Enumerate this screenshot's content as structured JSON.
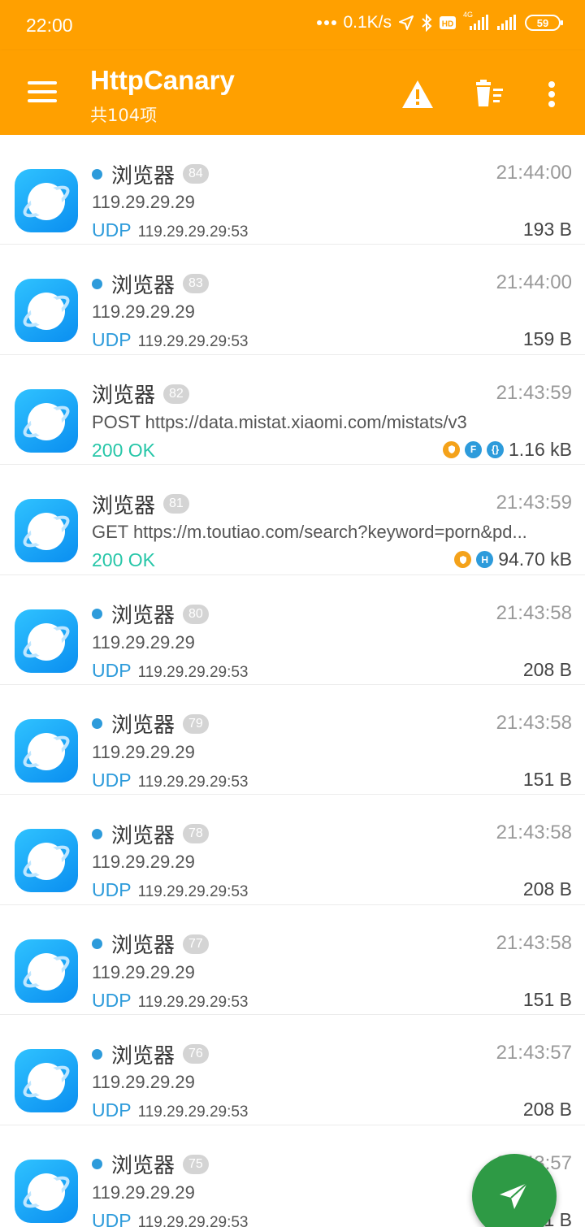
{
  "statusbar": {
    "time": "22:00",
    "speed": "0.1K/s",
    "network": "4G",
    "battery": "59",
    "icons": [
      "dots-icon",
      "location-arrow-icon",
      "bluetooth-icon",
      "hd-icon",
      "signal-icon",
      "signal-icon",
      "battery-icon"
    ]
  },
  "appbar": {
    "title": "HttpCanary",
    "subtitle": "共104项",
    "actions": [
      "warning-icon",
      "clear-list-icon",
      "more-vert-icon"
    ]
  },
  "rows": [
    {
      "dot": true,
      "app": "浏览器",
      "index": "84",
      "time": "21:44:00",
      "line2": "119.29.29.29",
      "protocol": "UDP",
      "dest": "119.29.29.29:53",
      "size": "193 B",
      "icons": []
    },
    {
      "dot": true,
      "app": "浏览器",
      "index": "83",
      "time": "21:44:00",
      "line2": "119.29.29.29",
      "protocol": "UDP",
      "dest": "119.29.29.29:53",
      "size": "159 B",
      "icons": []
    },
    {
      "dot": false,
      "app": "浏览器",
      "index": "82",
      "time": "21:43:59",
      "line2": "POST https://data.mistat.xiaomi.com/mistats/v3",
      "status": "200 OK",
      "size": "1.16 kB",
      "icons": [
        {
          "color": "orange",
          "label": "",
          "name": "https-lock-icon"
        },
        {
          "color": "blue",
          "label": "F",
          "name": "form-icon"
        },
        {
          "color": "blue",
          "label": "{}",
          "name": "json-icon"
        }
      ]
    },
    {
      "dot": false,
      "app": "浏览器",
      "index": "81",
      "time": "21:43:59",
      "line2": "GET https://m.toutiao.com/search?keyword=porn&pd...",
      "status": "200 OK",
      "size": "94.70 kB",
      "icons": [
        {
          "color": "orange",
          "label": "",
          "name": "https-lock-icon"
        },
        {
          "color": "blue",
          "label": "H",
          "name": "html-icon"
        }
      ]
    },
    {
      "dot": true,
      "app": "浏览器",
      "index": "80",
      "time": "21:43:58",
      "line2": "119.29.29.29",
      "protocol": "UDP",
      "dest": "119.29.29.29:53",
      "size": "208 B",
      "icons": []
    },
    {
      "dot": true,
      "app": "浏览器",
      "index": "79",
      "time": "21:43:58",
      "line2": "119.29.29.29",
      "protocol": "UDP",
      "dest": "119.29.29.29:53",
      "size": "151 B",
      "icons": []
    },
    {
      "dot": true,
      "app": "浏览器",
      "index": "78",
      "time": "21:43:58",
      "line2": "119.29.29.29",
      "protocol": "UDP",
      "dest": "119.29.29.29:53",
      "size": "208 B",
      "icons": []
    },
    {
      "dot": true,
      "app": "浏览器",
      "index": "77",
      "time": "21:43:58",
      "line2": "119.29.29.29",
      "protocol": "UDP",
      "dest": "119.29.29.29:53",
      "size": "151 B",
      "icons": []
    },
    {
      "dot": true,
      "app": "浏览器",
      "index": "76",
      "time": "21:43:57",
      "line2": "119.29.29.29",
      "protocol": "UDP",
      "dest": "119.29.29.29:53",
      "size": "208 B",
      "icons": []
    },
    {
      "dot": true,
      "app": "浏览器",
      "index": "75",
      "time": "21:43:57",
      "line2": "119.29.29.29",
      "protocol": "UDP",
      "dest": "119.29.29.29:53",
      "size": "1 B",
      "icons": []
    }
  ],
  "fab": {
    "icon": "send-icon"
  },
  "colors": {
    "appbar": "#FFA000",
    "udp": "#2D9BDB",
    "ok": "#26C6A8",
    "fab": "#2E9A45",
    "badge": "#d4d4d4"
  }
}
